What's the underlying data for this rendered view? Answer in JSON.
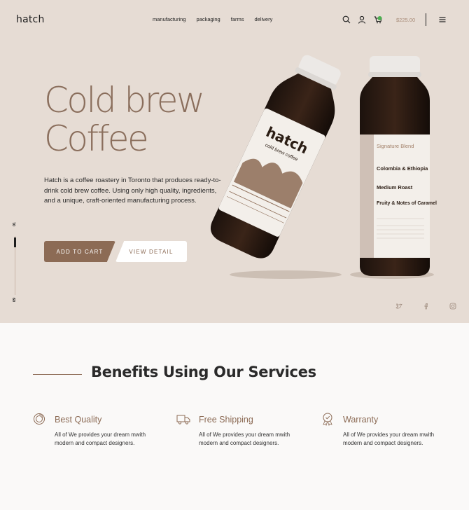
{
  "header": {
    "logo": "hatch",
    "nav": [
      "manufacturing",
      "packaging",
      "farms",
      "delivery"
    ],
    "cart_total": "$225.00"
  },
  "hero": {
    "title_line1": "Cold brew",
    "title_line2": "Coffee",
    "description": "Hatch is a coffee roastery in Toronto that produces ready-to-drink cold brew coffee. Using only high quality, ingredients, and a unique, craft-oriented manufacturing process.",
    "add_to_cart": "ADD TO CART",
    "view_detail": "VIEW DETAIL",
    "slide_current": "01",
    "slide_total": "09",
    "slide_progress": 0.11
  },
  "bottles": {
    "brand": "hatch",
    "tagline": "cold brew coffee",
    "blend": "Signature Blend",
    "origin": "Colombia & Ethiopia",
    "profile": "Medium Roast",
    "notes": "Fruity & Notes of Caramel"
  },
  "benefits": {
    "title": "Benefits Using Our Services",
    "items": [
      {
        "icon": "badge-icon",
        "title": "Best Quality",
        "text": "All of We provides your dream mwith modern and compact designers."
      },
      {
        "icon": "truck-icon",
        "title": "Free Shipping",
        "text": "All of We provides your dream mwith modern and compact designers."
      },
      {
        "icon": "medal-icon",
        "title": "Warranty",
        "text": "All of We provides your dream mwith modern and compact designers."
      }
    ]
  },
  "colors": {
    "hero_bg": "#e6dcd4",
    "accent": "#8c6b55",
    "title": "#8a6e5c",
    "cart_badge": "#4caf50"
  }
}
